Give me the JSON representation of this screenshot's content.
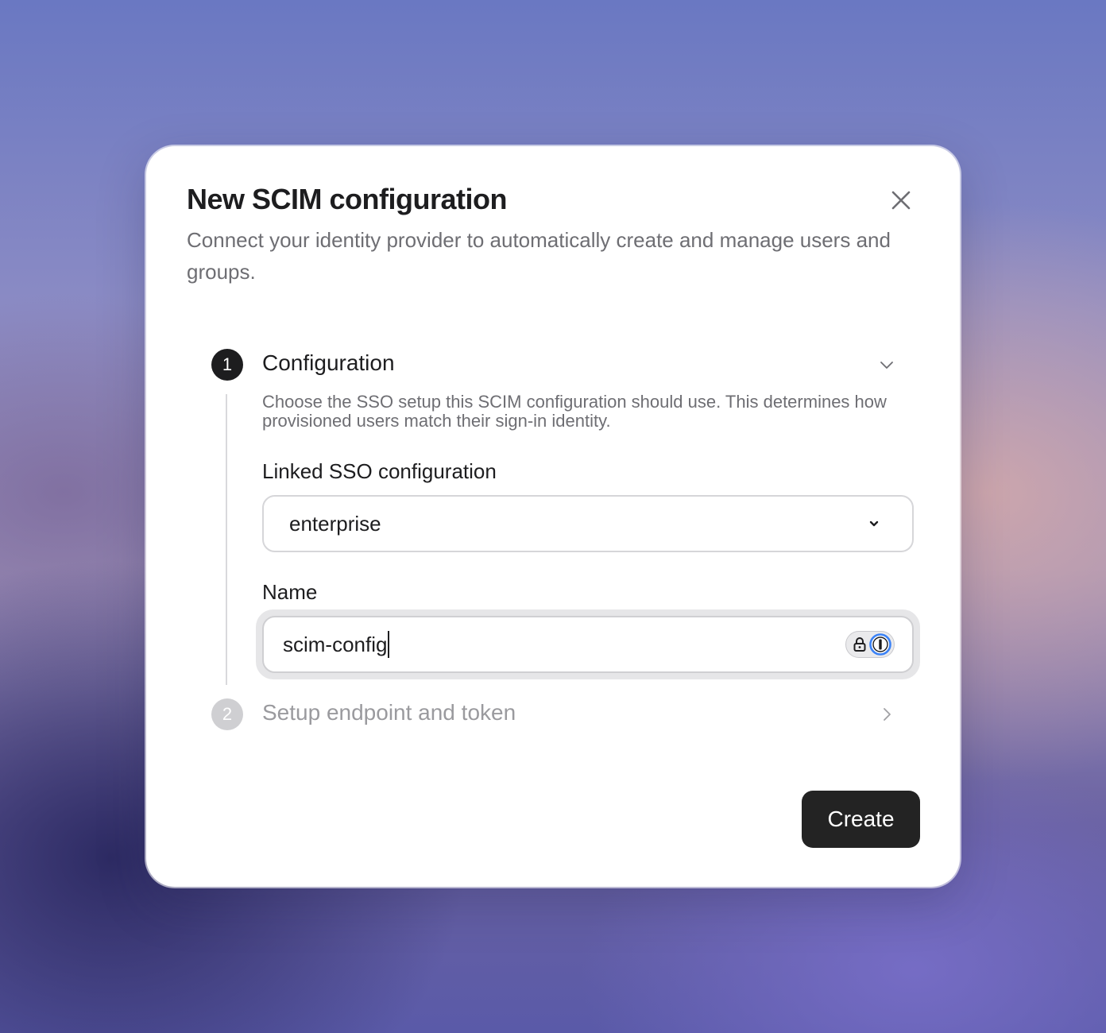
{
  "modal": {
    "title": "New SCIM configuration",
    "subtitle": "Connect your identity provider to automatically create and manage users and groups."
  },
  "steps": [
    {
      "number": "1",
      "title": "Configuration",
      "description": "Choose the SSO setup this SCIM configuration should use. This determines how provisioned users match their sign-in identity.",
      "expanded": true
    },
    {
      "number": "2",
      "title": "Setup endpoint and token",
      "expanded": false
    }
  ],
  "form": {
    "sso_label": "Linked SSO configuration",
    "sso_value": "enterprise",
    "name_label": "Name",
    "name_value": "scim-config"
  },
  "actions": {
    "create_label": "Create"
  },
  "colors": {
    "accent": "#1d1d1f",
    "password_manager": "#3b82f6"
  }
}
